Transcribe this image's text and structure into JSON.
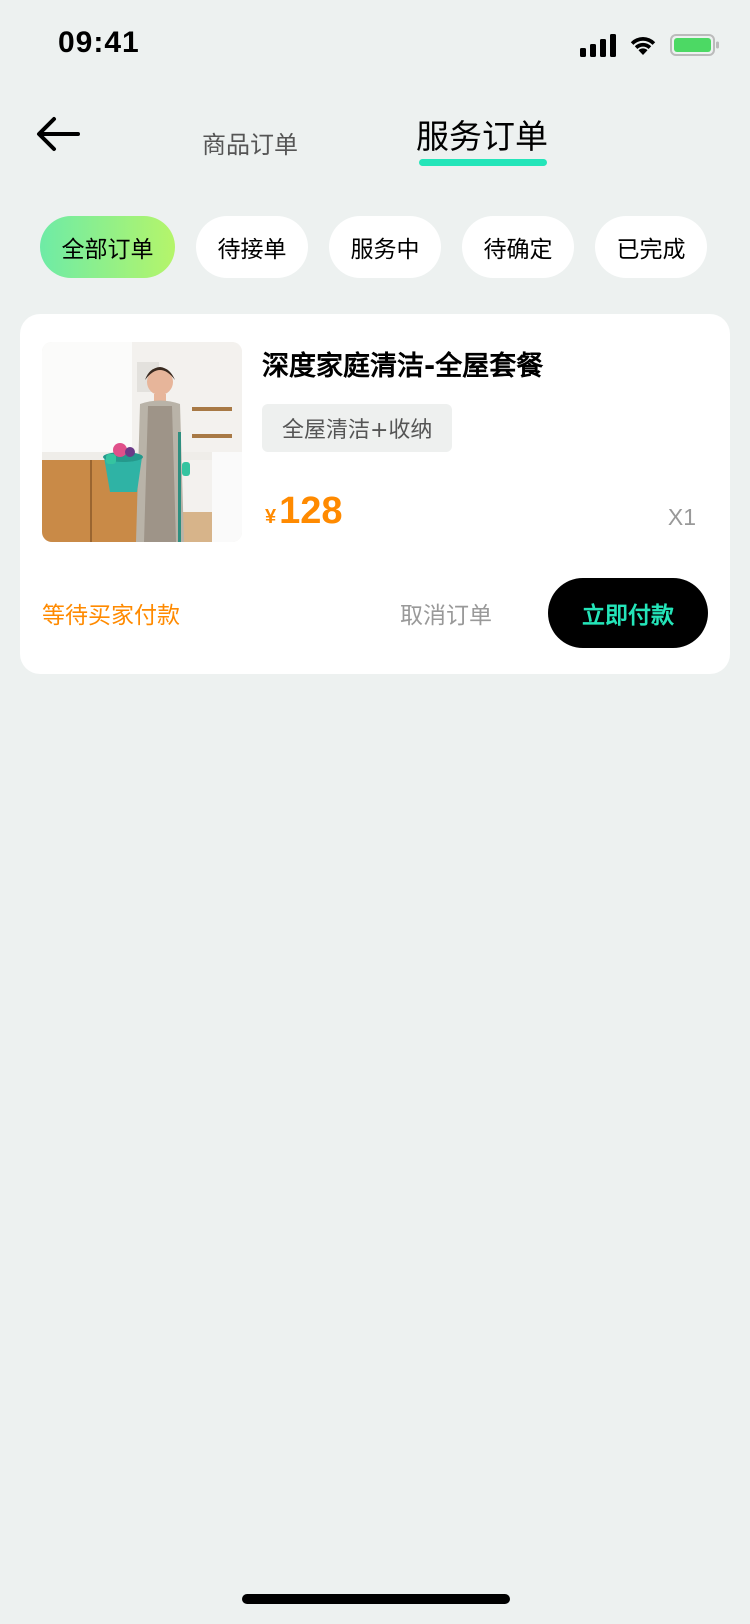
{
  "status_bar": {
    "time": "09:41"
  },
  "nav": {
    "tabs": [
      {
        "label": "商品订单"
      },
      {
        "label": "服务订单"
      }
    ],
    "active_tab": "服务订单"
  },
  "filters": [
    {
      "label": "全部订单",
      "active": true
    },
    {
      "label": "待接单"
    },
    {
      "label": "服务中"
    },
    {
      "label": "待确定"
    },
    {
      "label": "已完成"
    }
  ],
  "order": {
    "title": "深度家庭清洁-全屋套餐",
    "spec": "全屋清洁+收纳",
    "currency": "¥",
    "price": "128",
    "quantity": "X1",
    "status": "等待买家付款",
    "cancel_label": "取消订单",
    "pay_label": "立即付款",
    "image_icon": "housekeeper-photo"
  },
  "colors": {
    "background": "#EDF1F0",
    "accent": "#24E5B9",
    "price": "#FF8A00",
    "chip_gradient_start": "#6EEBA6",
    "chip_gradient_end": "#B5F56A",
    "battery": "#4CD964"
  }
}
